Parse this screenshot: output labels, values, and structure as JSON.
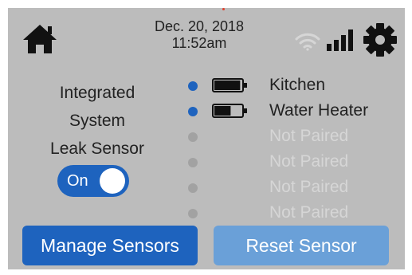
{
  "header": {
    "date": "Dec. 20, 2018",
    "time": "11:52am",
    "icons": [
      "home-icon",
      "wifi-icon",
      "signal-bars-icon",
      "gear-icon"
    ]
  },
  "title": {
    "line1": "Integrated",
    "line2": "System",
    "line3": "Leak Sensor"
  },
  "toggle": {
    "label": "On",
    "state": "on"
  },
  "sensors": [
    {
      "name": "Kitchen",
      "status": "paired",
      "battery_level": 0.95
    },
    {
      "name": "Water Heater",
      "status": "paired",
      "battery_level": 0.6
    },
    {
      "name": "Not Paired",
      "status": "unpaired"
    },
    {
      "name": "Not Paired",
      "status": "unpaired"
    },
    {
      "name": "Not Paired",
      "status": "unpaired"
    },
    {
      "name": "Not Paired",
      "status": "unpaired"
    }
  ],
  "buttons": {
    "manage_label": "Manage Sensors",
    "reset_label": "Reset Sensor"
  },
  "colors": {
    "background": "#bcbcbc",
    "primary": "#1e63be",
    "disabled_button": "#6aa0d8",
    "text": "#222222",
    "muted_text": "#d6d6d6",
    "unpaired_dot": "#a2a2a2",
    "wifi_inactive": "#d6d6d6"
  }
}
